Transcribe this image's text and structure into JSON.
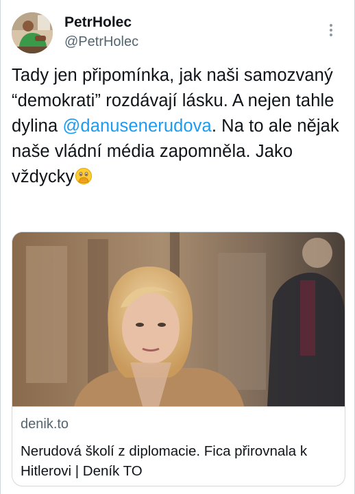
{
  "author": {
    "display_name": "PetrHolec",
    "handle": "@PetrHolec",
    "avatar_icon": "profile-photo"
  },
  "more_icon": "more-options-icon",
  "tweet": {
    "text_before": "Tady jen připomínka, jak naši samozvaný “demokrati” rozdávají lásku. A nejen tahle dylina ",
    "mention": "@danusenerudova",
    "text_after": ". Na to ale nějak naše vládní média zapomněla. Jako vždycky",
    "emoji": "face-with-open-eyes-and-hand-over-mouth"
  },
  "card": {
    "domain": "denik.to",
    "title": "Nerudová školí z diplomacie. Fica přirovnala k Hitlerovi | Deník TO"
  },
  "colors": {
    "link": "#1d9bf0",
    "secondary_text": "#536471",
    "border": "#cfd9de"
  }
}
